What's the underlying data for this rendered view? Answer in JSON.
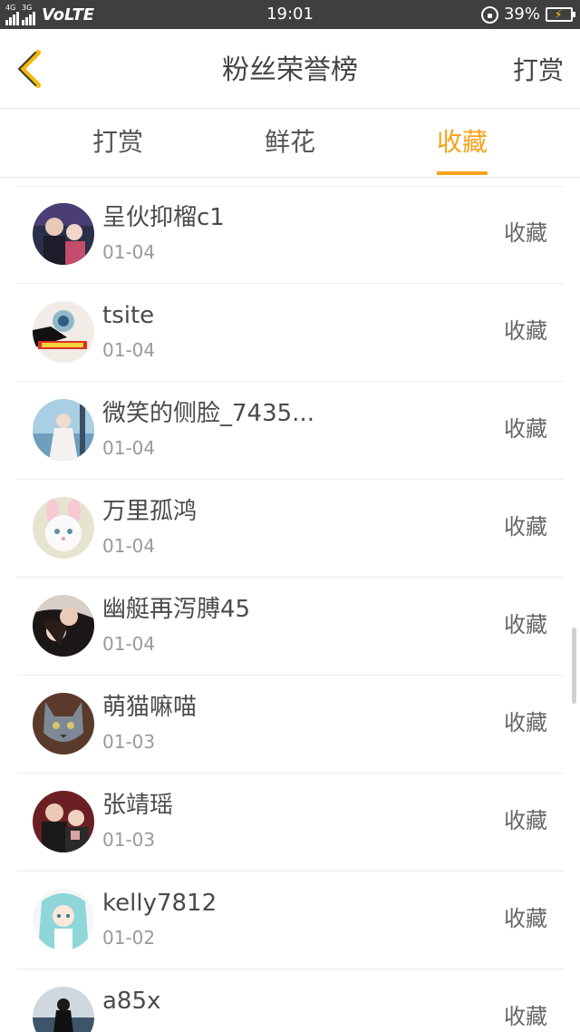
{
  "status_bar": {
    "signal1_tag": "4G",
    "signal2_tag": "3G",
    "network": "VoLTE",
    "time": "19:01",
    "battery_percent": "39%",
    "battery_level": 0.39,
    "battery_color": "#3ddc4b"
  },
  "header": {
    "back_icon": "chevron-left-icon",
    "back_color": "#f5b800",
    "title": "粉丝荣誉榜",
    "action_label": "打赏"
  },
  "tabs": {
    "items": [
      {
        "label": "打赏"
      },
      {
        "label": "鲜花"
      },
      {
        "label": "收藏"
      }
    ],
    "active_index": 2,
    "active_color": "#f5a21b"
  },
  "list": {
    "items": [
      {
        "name": "呈伙抑榴c1",
        "date": "01-04",
        "action": "收藏"
      },
      {
        "name": "tsite",
        "date": "01-04",
        "action": "收藏"
      },
      {
        "name": "微笑的侧脸_7435...",
        "date": "01-04",
        "action": "收藏"
      },
      {
        "name": "万里孤鸿",
        "date": "01-04",
        "action": "收藏"
      },
      {
        "name": "幽艇再泻膊45",
        "date": "01-04",
        "action": "收藏"
      },
      {
        "name": "萌猫嘛喵",
        "date": "01-03",
        "action": "收藏"
      },
      {
        "name": "张靖瑶",
        "date": "01-03",
        "action": "收藏"
      },
      {
        "name": "kelly7812",
        "date": "01-02",
        "action": "收藏"
      },
      {
        "name": "a85x",
        "date": "",
        "action": "收藏"
      }
    ]
  }
}
